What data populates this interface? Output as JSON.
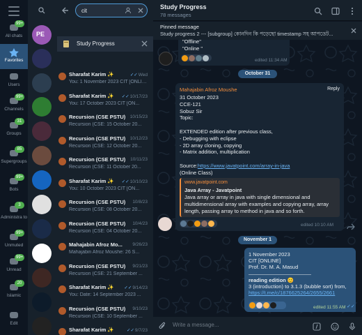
{
  "folders": [
    {
      "label": "All chats",
      "badge": "99+",
      "icon": "chat-bubbles-icon"
    },
    {
      "label": "Favorites",
      "badge": "",
      "icon": "star-icon"
    },
    {
      "label": "Users",
      "badge": "",
      "icon": "user-icon"
    },
    {
      "label": "Channels",
      "badge": "99+",
      "icon": "megaphone-icon"
    },
    {
      "label": "Groups",
      "badge": "31",
      "icon": "people-icon"
    },
    {
      "label": "Supergroups",
      "badge": "85",
      "icon": "people-icon"
    },
    {
      "label": "Bots",
      "badge": "99+",
      "icon": "bot-icon"
    },
    {
      "label": "Administra to",
      "badge": "3",
      "icon": "admin-icon"
    },
    {
      "label": "Unmuted",
      "badge": "99+",
      "icon": "bell-icon"
    },
    {
      "label": "Unread",
      "badge": "99+",
      "icon": "unread-icon"
    },
    {
      "label": "Islamic",
      "badge": "20",
      "icon": "folder-icon"
    },
    {
      "label": "Edit",
      "badge": "",
      "icon": "sliders-icon"
    }
  ],
  "search": {
    "value": "cit"
  },
  "filter": {
    "label": "Study Progress"
  },
  "results": [
    {
      "name": "Sharafat Karim ✨",
      "date": "Wed",
      "read": true,
      "text": "You: 1 November 2023 CIT [ONLINE]..."
    },
    {
      "name": "Sharafat Karim ✨",
      "date": "10/17/23",
      "read": true,
      "text": "You: 17 October 2023 CIT [ON..."
    },
    {
      "name": "Recursion (CSE PSTU)",
      "date": "10/15/23",
      "read": false,
      "text": "Recursion (CSE: 15 October 20..."
    },
    {
      "name": "Recursion (CSE PSTU)",
      "date": "10/12/23",
      "read": false,
      "text": "Recursion (CSE: 12 October 20..."
    },
    {
      "name": "Recursion (CSE PSTU)",
      "date": "10/11/23",
      "read": false,
      "text": "Recursion (CSE: 11 October 20..."
    },
    {
      "name": "Sharafat Karim ✨",
      "date": "10/10/23",
      "read": true,
      "text": "You: 10 October 2023 CIT [ON..."
    },
    {
      "name": "Recursion (CSE PSTU)",
      "date": "10/8/23",
      "read": false,
      "text": "Recursion (CSE: 08 October 20..."
    },
    {
      "name": "Recursion (CSE PSTU)",
      "date": "10/4/23",
      "read": false,
      "text": "Recursion (CSE: 04 October 20..."
    },
    {
      "name": "Mahajabin Afroz Mo...",
      "date": "9/26/23",
      "read": false,
      "text": "Mahajabin Afroz Moushe: 26 S..."
    },
    {
      "name": "Recursion (CSE PSTU)",
      "date": "9/21/23",
      "read": false,
      "text": "Recursion (CSE: 21 September ..."
    },
    {
      "name": "Sharafat Karim ✨",
      "date": "9/14/23",
      "read": true,
      "text": "You: Date: 14 September 2023 ..."
    },
    {
      "name": "Recursion (CSE PSTU)",
      "date": "9/10/23",
      "read": false,
      "text": "Recursion (CSE: 10 September ..."
    },
    {
      "name": "Sharafat Karim ✨",
      "date": "9/7/23",
      "read": true,
      "text": ""
    }
  ],
  "chat": {
    "title": "Study Progress",
    "subtitle": "78 messages",
    "pinned_title": "Pinned message",
    "pinned_text": "Study progress 2 --- [subgroup] কোনদিন কি পড়েছো timestamp সহ আপডেট..."
  },
  "top_msg": {
    "line1": "\"Offline\"",
    "line2": "\"Online \"",
    "time": "edited 11:34 AM"
  },
  "date1": "October 31",
  "msg1": {
    "sender": "Mahajabin Afroz Moushe",
    "reply": "Reply",
    "body_lines": [
      "31 October 2023",
      "CCE-121",
      "Sobuz Sir",
      "Topic:",
      "",
      "EXTENDED edition after previous class,",
      "- Debugging with eclipse",
      "- 2D array cloning, copying",
      "- Matrix addition, multiplication",
      ""
    ],
    "source_prefix": "Source:",
    "source_link": "https://www.javatpoint.com/array-in-java",
    "online_class": "(Online Class)",
    "preview_site": "www.javatpoint.com",
    "preview_title": "Java Array - Javatpoint",
    "preview_desc": "Java array or array in java with single dimensional and multidimensional array with examples and copying array, array length, passing array to method in java and so forth.",
    "time": "edited 10:10 AM"
  },
  "date2": "November 1",
  "msg2": {
    "lines": [
      "1 November 2023",
      "CIT [ONLINE]",
      "Prof. Dr. M. A. Masud",
      "————————————"
    ],
    "reading": "reading edition 😊",
    "desc": "3 (introduction) to 3.1.3 (bubble sort) from,",
    "link": "https://t.me/c/1876625264/2655/2661",
    "time": "edited 11:55 AM"
  },
  "composer": {
    "placeholder": "Write a message..."
  },
  "colors": {
    "accent": "#2b5278",
    "link": "#6ab3f3",
    "sender": "#f38e3d",
    "badge": "#4fae4e"
  }
}
